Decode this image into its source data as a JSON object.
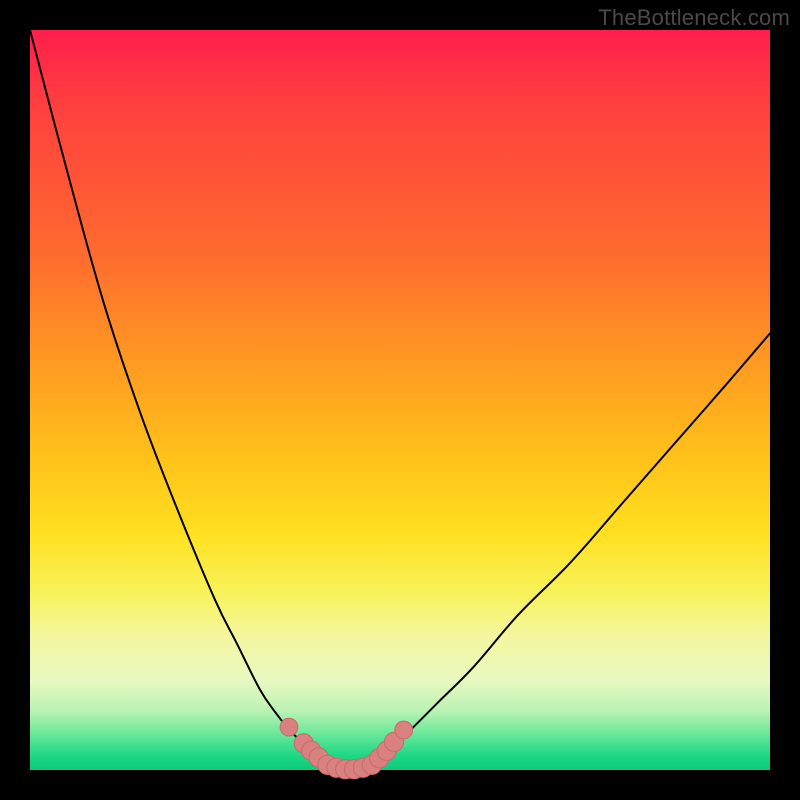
{
  "attribution": "TheBottleneck.com",
  "chart_data": {
    "type": "line",
    "title": "",
    "xlabel": "",
    "ylabel": "",
    "xlim": [
      0,
      100
    ],
    "ylim": [
      0,
      100
    ],
    "series": [
      {
        "name": "left-curve",
        "x": [
          0,
          5,
          10,
          15,
          20,
          25,
          28,
          31,
          33,
          35,
          37,
          39,
          40
        ],
        "y": [
          100,
          81,
          63,
          48,
          35,
          23,
          17,
          11,
          8,
          5.5,
          3.5,
          1.8,
          0.6
        ]
      },
      {
        "name": "right-curve",
        "x": [
          46,
          48,
          51,
          55,
          60,
          66,
          73,
          80,
          87,
          94,
          100
        ],
        "y": [
          0.6,
          2.2,
          5,
          9,
          14,
          21,
          28,
          36,
          44,
          52,
          59
        ]
      },
      {
        "name": "valley-floor",
        "x": [
          40,
          41,
          42,
          43,
          44,
          45,
          46
        ],
        "y": [
          0.6,
          0.2,
          0.0,
          0.0,
          0.0,
          0.2,
          0.6
        ]
      }
    ],
    "markers": [
      {
        "name": "left-marker-upper",
        "x": 35.0,
        "y": 5.8,
        "r": 1.2
      },
      {
        "name": "left-marker-lower1",
        "x": 37.0,
        "y": 3.6,
        "r": 1.3
      },
      {
        "name": "left-marker-lower2",
        "x": 38.0,
        "y": 2.6,
        "r": 1.3
      },
      {
        "name": "left-marker-lower3",
        "x": 39.0,
        "y": 1.7,
        "r": 1.3
      },
      {
        "name": "floor-marker-1",
        "x": 40.2,
        "y": 0.7,
        "r": 1.3
      },
      {
        "name": "floor-marker-2",
        "x": 41.4,
        "y": 0.3,
        "r": 1.3
      },
      {
        "name": "floor-marker-3",
        "x": 42.6,
        "y": 0.1,
        "r": 1.3
      },
      {
        "name": "floor-marker-4",
        "x": 43.8,
        "y": 0.1,
        "r": 1.3
      },
      {
        "name": "floor-marker-5",
        "x": 45.0,
        "y": 0.3,
        "r": 1.3
      },
      {
        "name": "floor-marker-6",
        "x": 46.2,
        "y": 0.7,
        "r": 1.3
      },
      {
        "name": "right-marker-1",
        "x": 47.2,
        "y": 1.6,
        "r": 1.3
      },
      {
        "name": "right-marker-2",
        "x": 48.2,
        "y": 2.6,
        "r": 1.3
      },
      {
        "name": "right-marker-3",
        "x": 49.2,
        "y": 3.8,
        "r": 1.3
      },
      {
        "name": "right-marker-upper",
        "x": 50.5,
        "y": 5.4,
        "r": 1.2
      }
    ],
    "colors": {
      "curve": "#000000",
      "marker_fill": "#d98080",
      "marker_stroke": "#c86a6a"
    }
  }
}
